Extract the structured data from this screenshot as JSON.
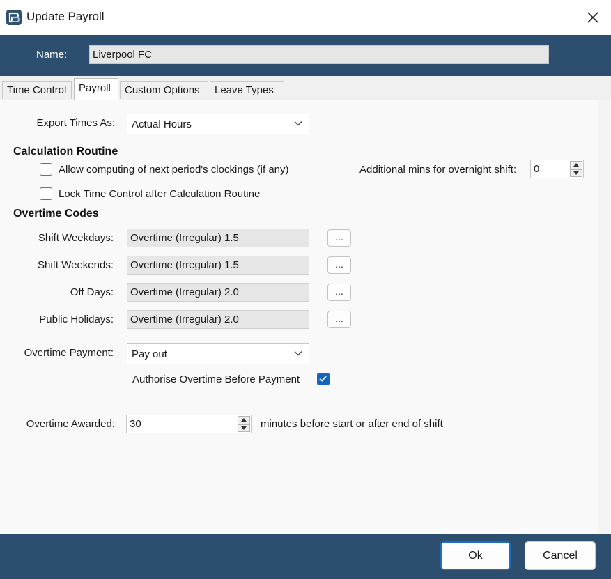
{
  "window": {
    "title": "Update Payroll",
    "close_icon": "close-icon"
  },
  "header": {
    "name_label": "Name:",
    "name_value": "Liverpool FC"
  },
  "tabs": [
    {
      "label": "Time Control",
      "active": false
    },
    {
      "label": "Payroll",
      "active": true
    },
    {
      "label": "Custom Options",
      "active": false
    },
    {
      "label": "Leave Types",
      "active": false
    }
  ],
  "payroll": {
    "export_times_label": "Export Times As:",
    "export_times_value": "Actual Hours",
    "calculation_heading": "Calculation Routine",
    "allow_computing_label": "Allow computing of next period's clockings (if any)",
    "allow_computing_checked": false,
    "lock_time_control_label": "Lock Time Control after Calculation Routine",
    "lock_time_control_checked": false,
    "additional_mins_label": "Additional mins for overnight shift:",
    "additional_mins_value": "0",
    "overtime_heading": "Overtime Codes",
    "overtime_codes": [
      {
        "label": "Shift Weekdays:",
        "value": "Overtime (Irregular) 1.5",
        "button": "..."
      },
      {
        "label": "Shift Weekends:",
        "value": "Overtime (Irregular) 1.5",
        "button": "..."
      },
      {
        "label": "Off Days:",
        "value": "Overtime (Irregular) 2.0",
        "button": "..."
      },
      {
        "label": "Public Holidays:",
        "value": "Overtime (Irregular) 2.0",
        "button": "..."
      }
    ],
    "overtime_payment_label": "Overtime Payment:",
    "overtime_payment_value": "Pay out",
    "authorise_label": "Authorise Overtime Before Payment",
    "authorise_checked": true,
    "overtime_awarded_label": "Overtime Awarded:",
    "overtime_awarded_value": "30",
    "overtime_awarded_suffix": "minutes before start or after end of shift"
  },
  "footer": {
    "ok_label": "Ok",
    "cancel_label": "Cancel"
  },
  "colors": {
    "header_band": "#2c4f70",
    "primary_border": "#1a6fc4",
    "checkbox_checked": "#1565c0"
  }
}
